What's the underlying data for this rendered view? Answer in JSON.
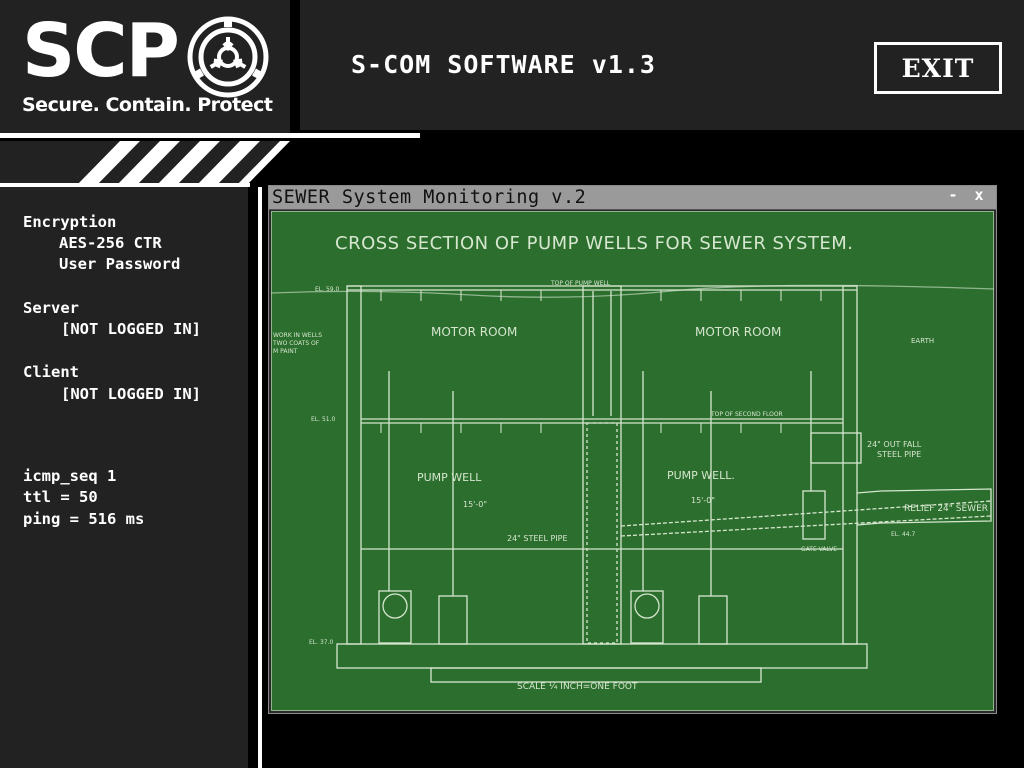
{
  "header": {
    "logo_text": "SCP",
    "logo_tagline": "Secure. Contain. Protect",
    "app_title": "S-COM SOFTWARE v1.3",
    "exit_label": "EXIT"
  },
  "sidebar": {
    "encryption_heading": "Encryption",
    "encryption_algo": "AES-256 CTR",
    "encryption_mode": "User Password",
    "server_heading": "Server",
    "server_status": "[NOT LOGGED IN]",
    "client_heading": "Client",
    "client_status": "[NOT LOGGED IN]",
    "icmp_seq": "icmp_seq 1",
    "ttl": "ttl = 50",
    "ping": "ping = 516 ms"
  },
  "window": {
    "title": "SEWER System Monitoring v.2",
    "minimize_label": "-",
    "close_label": "x"
  },
  "blueprint": {
    "title": "CROSS SECTION OF PUMP WELLS FOR SEWER SYSTEM.",
    "motor_room_left": "MOTOR ROOM",
    "motor_room_right": "MOTOR ROOM",
    "pump_well_left": "PUMP WELL",
    "pump_well_right": "PUMP WELL.",
    "dim_left": "15'-0\"",
    "dim_right": "15'-0\"",
    "steel_pipe": "24\" STEEL PIPE",
    "outfall_pipe_1": "24\" OUT FALL",
    "outfall_pipe_2": "STEEL PIPE",
    "relief_sewer": "RELIEF 24\" SEWER",
    "earth": "EARTH",
    "top_of_pump_well": "TOP OF PUMP WELL",
    "top_second_floor": "TOP OF SECOND FLOOR",
    "el_59": "EL. 59.0",
    "el_51": "EL. 51.0",
    "el_37": "EL. 37.0",
    "el_447": "EL. 44.7",
    "gate_valve": "GATE VALVE",
    "note_left_1": "WORK IN WELLS",
    "note_left_2": "TWO COATS OF",
    "note_left_3": "M PAINT",
    "scale": "SCALE ¼ INCH=ONE FOOT",
    "colors": {
      "background": "#2b6e2d",
      "ink": "#d6e6cf"
    }
  }
}
